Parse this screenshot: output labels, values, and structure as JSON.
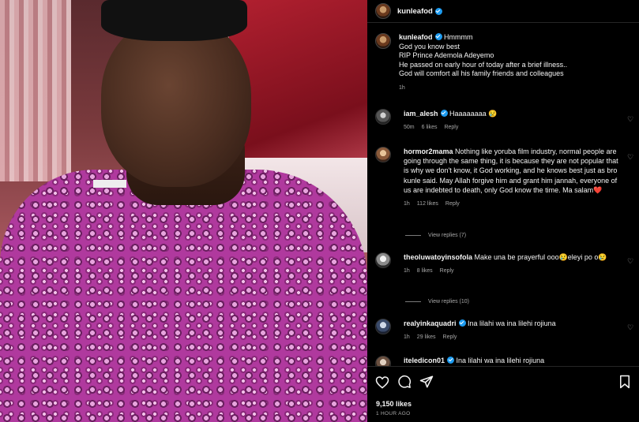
{
  "post": {
    "username": "kunleafod",
    "caption_lines": [
      "Hmmmm",
      "God you know best",
      "RIP Prince Ademola Adeyemo",
      "He passed on early hour of today after a brief illness..",
      "God will comfort all his family friends and colleagues"
    ],
    "time": "1h"
  },
  "comments": [
    {
      "username": "iam_alesh",
      "verified": true,
      "text": "Haaaaaaaa 😢",
      "time": "50m",
      "likes": "6 likes",
      "reply": "Reply"
    },
    {
      "username": "hormor2mama",
      "verified": false,
      "text": "Nothing like yoruba film industry, normal people are going through the same thing, it is because they are not popular that is why we don't know, it God working, and he knows best just as bro kunle said. May Allah forgive him and grant him jannah, everyone of us are indebted to death, only God know the time. Ma salam❤️",
      "time": "1h",
      "likes": "112 likes",
      "reply": "Reply",
      "view_replies": "View replies (7)"
    },
    {
      "username": "theoluwatoyinsofola",
      "verified": false,
      "text": "Make una be prayerful ooo😢eleyi po o😢",
      "time": "1h",
      "likes": "8 likes",
      "reply": "Reply",
      "view_replies": "View replies (10)"
    },
    {
      "username": "realyinkaquadri",
      "verified": true,
      "text": "Ina lilahi wa ina lilehi rojiuna",
      "time": "1h",
      "likes": "29 likes",
      "reply": "Reply"
    },
    {
      "username": "iteledicon01",
      "verified": true,
      "text": "Ina lilahi wa ina lilehi rojiuna"
    }
  ],
  "footer": {
    "likes": "9,150 likes",
    "ago": "1 HOUR AGO"
  },
  "icons": {
    "like": "heart-icon",
    "comment": "comment-icon",
    "share": "share-icon",
    "save": "bookmark-icon"
  },
  "colors": {
    "background": "#000000",
    "verified": "#1d9bf0",
    "muted": "#a8a8a8"
  }
}
